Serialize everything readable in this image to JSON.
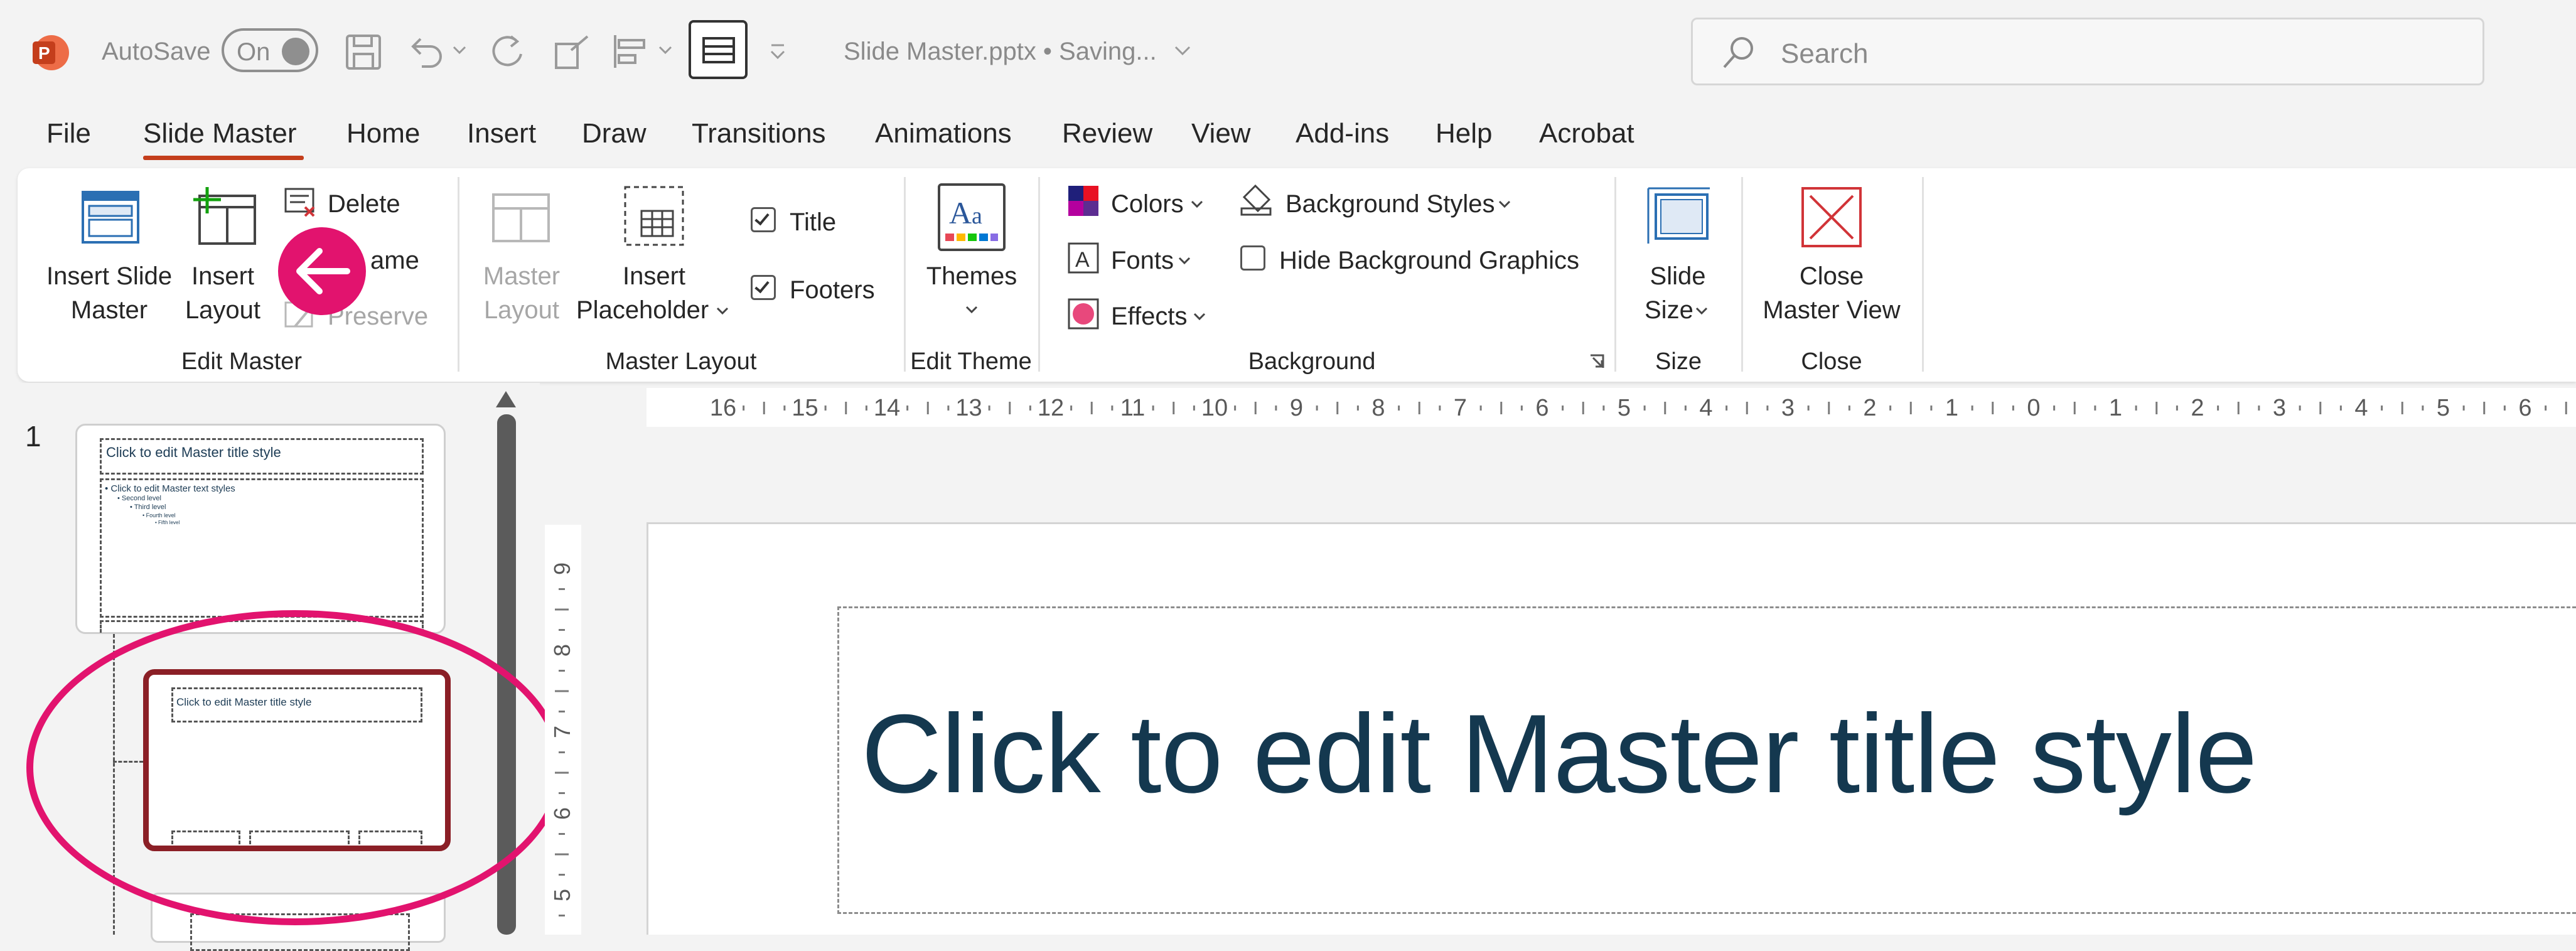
{
  "titlebar": {
    "autosave_label": "AutoSave",
    "autosave_state": "On",
    "filename": "Slide Master.pptx • Saving...",
    "search_placeholder": "Search"
  },
  "tabs": [
    "File",
    "Slide Master",
    "Home",
    "Insert",
    "Draw",
    "Transitions",
    "Animations",
    "Review",
    "View",
    "Add-ins",
    "Help",
    "Acrobat"
  ],
  "ribbon": {
    "edit_master": {
      "insert_slide_master_l1": "Insert Slide",
      "insert_slide_master_l2": "Master",
      "insert_layout_l1": "Insert",
      "insert_layout_l2": "Layout",
      "delete": "Delete",
      "rename": "ame",
      "preserve": "Preserve",
      "group_label": "Edit Master"
    },
    "master_layout": {
      "master_layout_l1": "Master",
      "master_layout_l2": "Layout",
      "insert_placeholder_l1": "Insert",
      "insert_placeholder_l2": "Placeholder",
      "title": "Title",
      "footers": "Footers",
      "group_label": "Master Layout"
    },
    "edit_theme": {
      "themes": "Themes",
      "group_label": "Edit Theme"
    },
    "background": {
      "colors": "Colors",
      "fonts": "Fonts",
      "effects": "Effects",
      "background_styles": "Background Styles",
      "hide_background_graphics": "Hide Background Graphics",
      "group_label": "Background"
    },
    "size": {
      "slide_size_l1": "Slide",
      "slide_size_l2": "Size",
      "group_label": "Size"
    },
    "close": {
      "close_l1": "Close",
      "close_l2": "Master View",
      "group_label": "Close"
    }
  },
  "thumbnails": {
    "slide_number": "1",
    "thumb1_title": "Click to edit Master title style",
    "thumb1_body": "• Click to edit Master text styles",
    "thumb1_l2": "• Second level",
    "thumb1_l3": "• Third level",
    "thumb1_l4": "• Fourth level",
    "thumb1_l5": "• Fifth level",
    "thumb2_title": "Click to edit Master title style"
  },
  "ruler_h": [
    "16",
    "15",
    "14",
    "13",
    "12",
    "11",
    "10",
    "9",
    "8",
    "7",
    "6",
    "5",
    "4",
    "3",
    "2",
    "1",
    "0",
    "1",
    "2",
    "3",
    "4",
    "5",
    "6"
  ],
  "ruler_v": [
    "9",
    "8",
    "7",
    "6",
    "5"
  ],
  "slide": {
    "title": "Click to edit Master title style"
  },
  "colors": {
    "accent_tab": "#c43e1c",
    "annotation": "#e2136e",
    "selected_thumb": "#8b1f26",
    "title_text": "#14384f"
  }
}
